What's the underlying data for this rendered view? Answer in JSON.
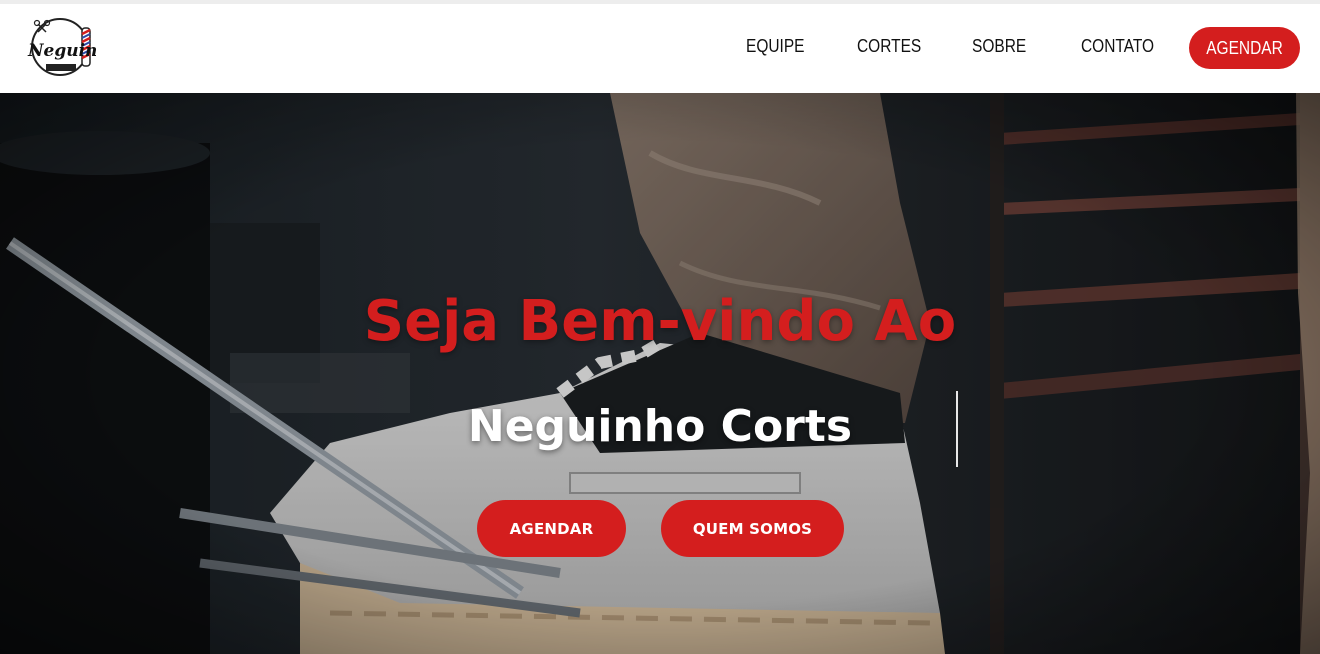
{
  "brand": {
    "logo_text": "Neguinho",
    "logo_icon": "barber-logo-icon"
  },
  "nav": {
    "links": [
      {
        "label": "EQUIPE"
      },
      {
        "label": "CORTES"
      },
      {
        "label": "SOBRE"
      },
      {
        "label": "CONTATO"
      }
    ],
    "cta_label": "AGENDAR"
  },
  "hero": {
    "title": "Seja Bem-vindo Ao",
    "subtitle": "Neguinho Corts",
    "buttons": {
      "primary_label": "AGENDAR",
      "secondary_label": "QUEM SOMOS"
    }
  },
  "colors": {
    "accent": "#d41e1e",
    "nav_bg": "#ffffff",
    "hero_text": "#ffffff"
  }
}
